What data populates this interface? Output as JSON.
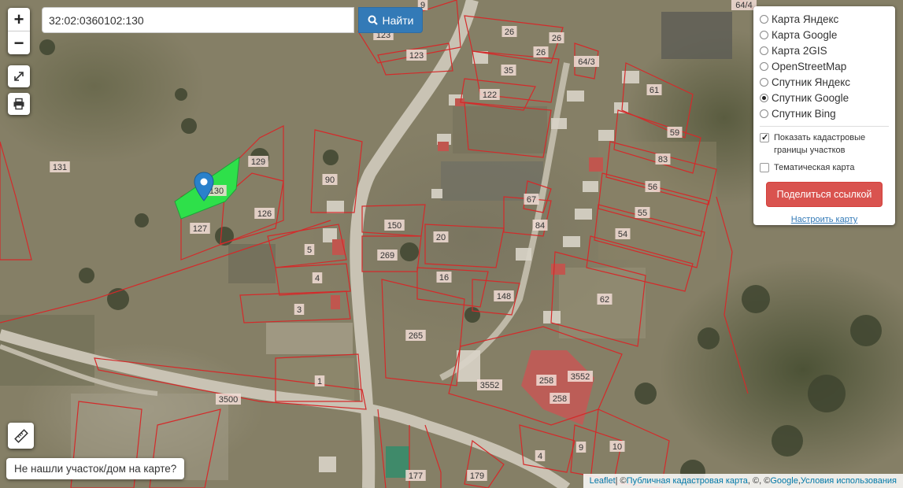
{
  "search": {
    "value": "32:02:0360102:130",
    "button_label": "Найти"
  },
  "zoom": {
    "in_label": "+",
    "out_label": "−"
  },
  "layers": {
    "options": [
      {
        "label": "Карта Яндекс",
        "selected": false
      },
      {
        "label": "Карта Google",
        "selected": false
      },
      {
        "label": "Карта 2GIS",
        "selected": false
      },
      {
        "label": "OpenStreetMap",
        "selected": false
      },
      {
        "label": "Спутник Яндекс",
        "selected": false
      },
      {
        "label": "Спутник Google",
        "selected": true
      },
      {
        "label": "Спутник Bing",
        "selected": false
      }
    ],
    "show_cadastral": {
      "label": "Показать кадастровые границы участков",
      "checked": true
    },
    "thematic": {
      "label": "Тематическая карта",
      "checked": false
    },
    "share_label": "Поделиться ссылкой",
    "configure_label": "Настроить карту"
  },
  "not_found_label": "Не нашли участок/дом на карте?",
  "attribution": {
    "leaflet": "Leaflet",
    "sep1": " | © ",
    "cadastral": "Публичная кадастровая карта",
    "sep2": ", ©, © ",
    "google": "Google",
    "sep3": ", ",
    "terms": "Условия использования"
  },
  "parcels": [
    "9",
    "26",
    "26",
    "26",
    "64/4",
    "123",
    "123",
    "35",
    "64/3",
    "122",
    "61",
    "59",
    "83",
    "56",
    "55",
    "54",
    "62",
    "131",
    "129",
    "130",
    "126",
    "127",
    "90",
    "150",
    "269",
    "20",
    "16",
    "84",
    "67",
    "148",
    "5",
    "4",
    "3",
    "265",
    "1",
    "3500",
    "3552",
    "258",
    "3552",
    "258",
    "4",
    "9",
    "10",
    "177",
    "179"
  ],
  "colors": {
    "boundary": "#d42a2a",
    "selected_parcel": "#2ee04a",
    "marker": "#2a81cb",
    "share": "#d9534f",
    "find": "#337ab7"
  }
}
